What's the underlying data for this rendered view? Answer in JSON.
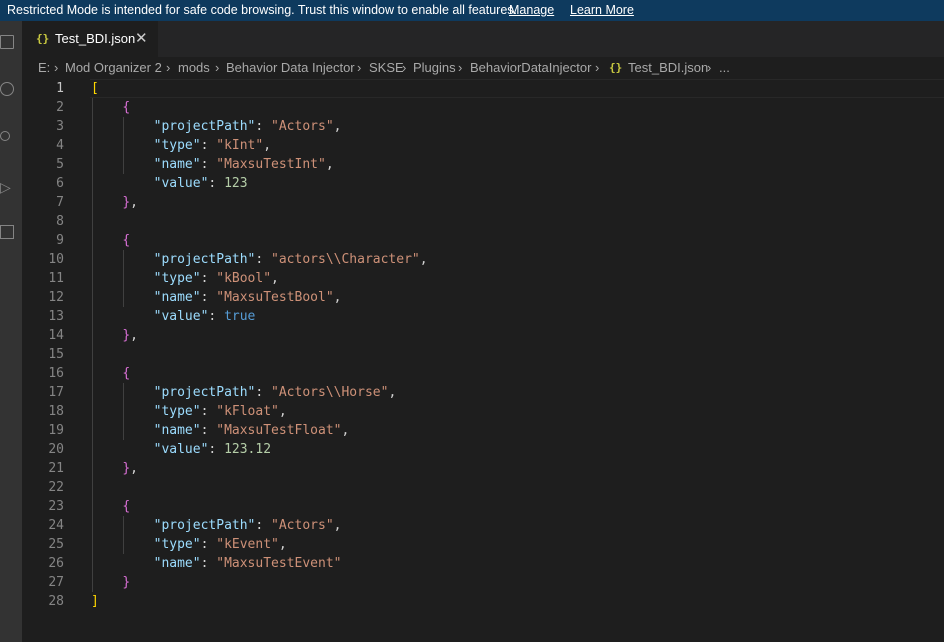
{
  "banner": {
    "message": "Restricted Mode is intended for safe code browsing. Trust this window to enable all features.",
    "manage_label": "Manage",
    "learn_more_label": "Learn More"
  },
  "tab": {
    "icon": "{}",
    "file_name": "Test_BDI.json",
    "close_glyph": "✕"
  },
  "breadcrumb": {
    "segments": [
      "E:",
      "Mod Organizer 2",
      "mods",
      "Behavior Data Injector",
      "SKSE",
      "Plugins",
      "BehaviorDataInjector"
    ],
    "file_icon": "{}",
    "file_name": "Test_BDI.json",
    "trailing": "..."
  },
  "editor": {
    "active_line": 1,
    "line_numbers": [
      "1",
      "2",
      "3",
      "4",
      "5",
      "6",
      "7",
      "8",
      "9",
      "10",
      "11",
      "12",
      "13",
      "14",
      "15",
      "16",
      "17",
      "18",
      "19",
      "20",
      "21",
      "22",
      "23",
      "24",
      "25",
      "26",
      "27",
      "28"
    ],
    "entries": [
      {
        "projectPath": "\"Actors\"",
        "type": "\"kInt\"",
        "name": "\"MaxsuTestInt\"",
        "value": "123"
      },
      {
        "projectPath": "\"actors\\\\Character\"",
        "type": "\"kBool\"",
        "name": "\"MaxsuTestBool\"",
        "value": "true"
      },
      {
        "projectPath": "\"Actors\\\\Horse\"",
        "type": "\"kFloat\"",
        "name": "\"MaxsuTestFloat\"",
        "value": "123.12"
      },
      {
        "projectPath": "\"Actors\"",
        "type": "\"kEvent\"",
        "name": "\"MaxsuTestEvent\""
      }
    ],
    "keys": {
      "projectPath": "\"projectPath\"",
      "type": "\"type\"",
      "name": "\"name\"",
      "value": "\"value\""
    }
  },
  "colors": {
    "banner_bg": "#0e3a5e",
    "editor_bg": "#1e1e1e",
    "key": "#9cdcfe",
    "string": "#ce9178",
    "number": "#b5cea8",
    "boolean": "#569cd6",
    "bracket_outer": "#ffd700",
    "bracket_inner": "#da70d6"
  }
}
